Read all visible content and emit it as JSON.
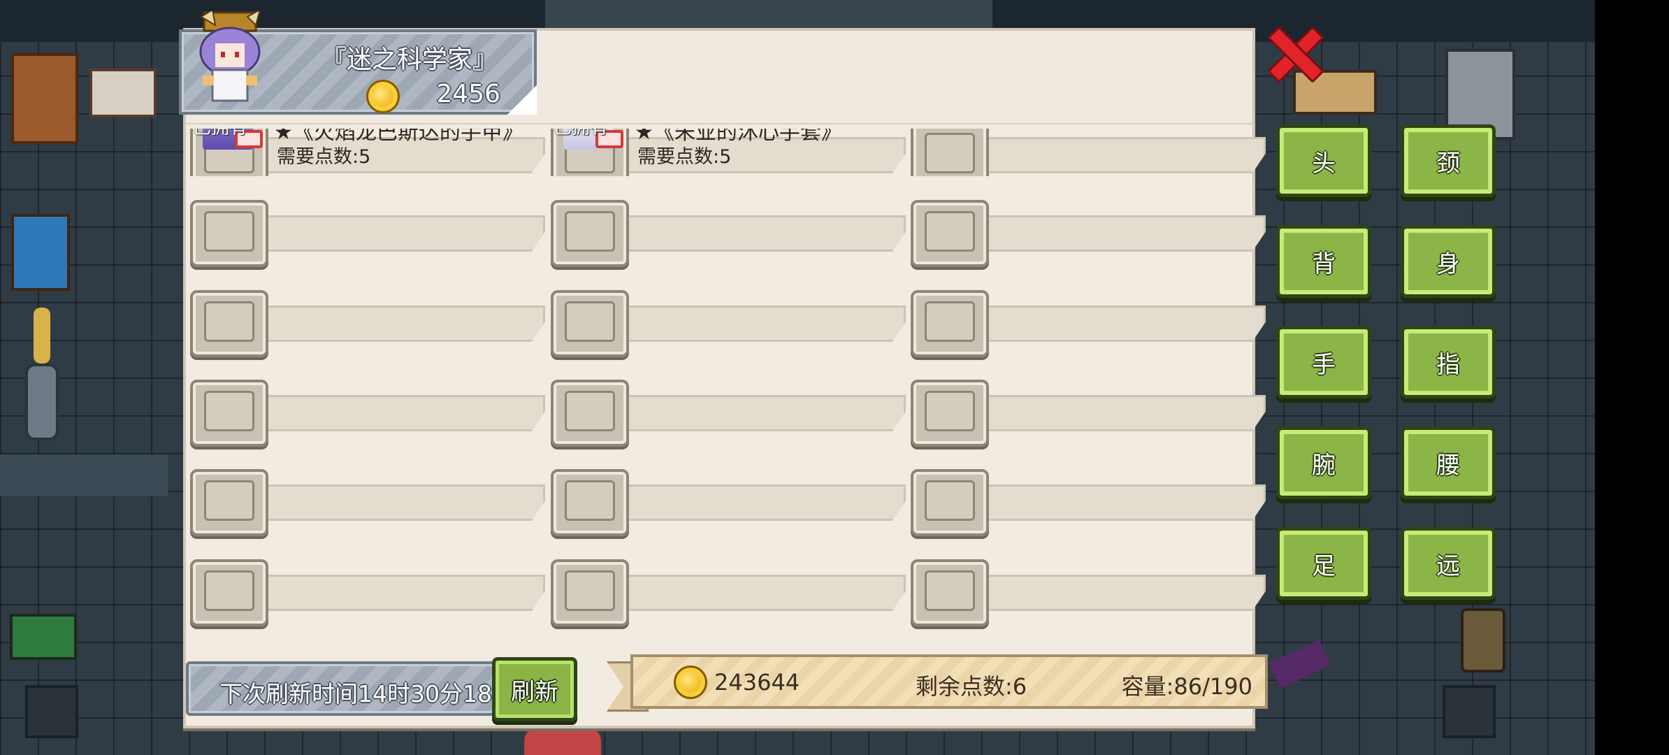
{
  "shop": {
    "title": "『迷之科学家』",
    "price": "2456"
  },
  "items": [
    {
      "owned": "已拥有",
      "name": "★《火焰龙巴斯达的手甲》",
      "cost": "需要点数:5",
      "art": "purple"
    },
    {
      "owned": "已拥有",
      "name": "★《朱业的沐心手套》",
      "cost": "需要点数:5",
      "art": "white"
    },
    {
      "owned": "",
      "name": "",
      "cost": ""
    },
    {
      "owned": "",
      "name": "",
      "cost": ""
    },
    {
      "owned": "",
      "name": "",
      "cost": ""
    },
    {
      "owned": "",
      "name": "",
      "cost": ""
    },
    {
      "owned": "",
      "name": "",
      "cost": ""
    },
    {
      "owned": "",
      "name": "",
      "cost": ""
    },
    {
      "owned": "",
      "name": "",
      "cost": ""
    },
    {
      "owned": "",
      "name": "",
      "cost": ""
    },
    {
      "owned": "",
      "name": "",
      "cost": ""
    },
    {
      "owned": "",
      "name": "",
      "cost": ""
    },
    {
      "owned": "",
      "name": "",
      "cost": ""
    },
    {
      "owned": "",
      "name": "",
      "cost": ""
    },
    {
      "owned": "",
      "name": "",
      "cost": ""
    },
    {
      "owned": "",
      "name": "",
      "cost": ""
    },
    {
      "owned": "",
      "name": "",
      "cost": ""
    },
    {
      "owned": "",
      "name": "",
      "cost": ""
    }
  ],
  "footer": {
    "refresh_time": "下次刷新时间14时30分18",
    "refresh_label": "刷新",
    "gold": "243644",
    "points": "剩余点数:6",
    "capacity": "容量:86/190"
  },
  "categories": [
    "头",
    "颈",
    "背",
    "身",
    "手",
    "指",
    "腕",
    "腰",
    "足",
    "远"
  ],
  "colors": {
    "accent_green": "#8cb548",
    "close_red": "#e2232a",
    "panel": "#f1ebe1"
  }
}
